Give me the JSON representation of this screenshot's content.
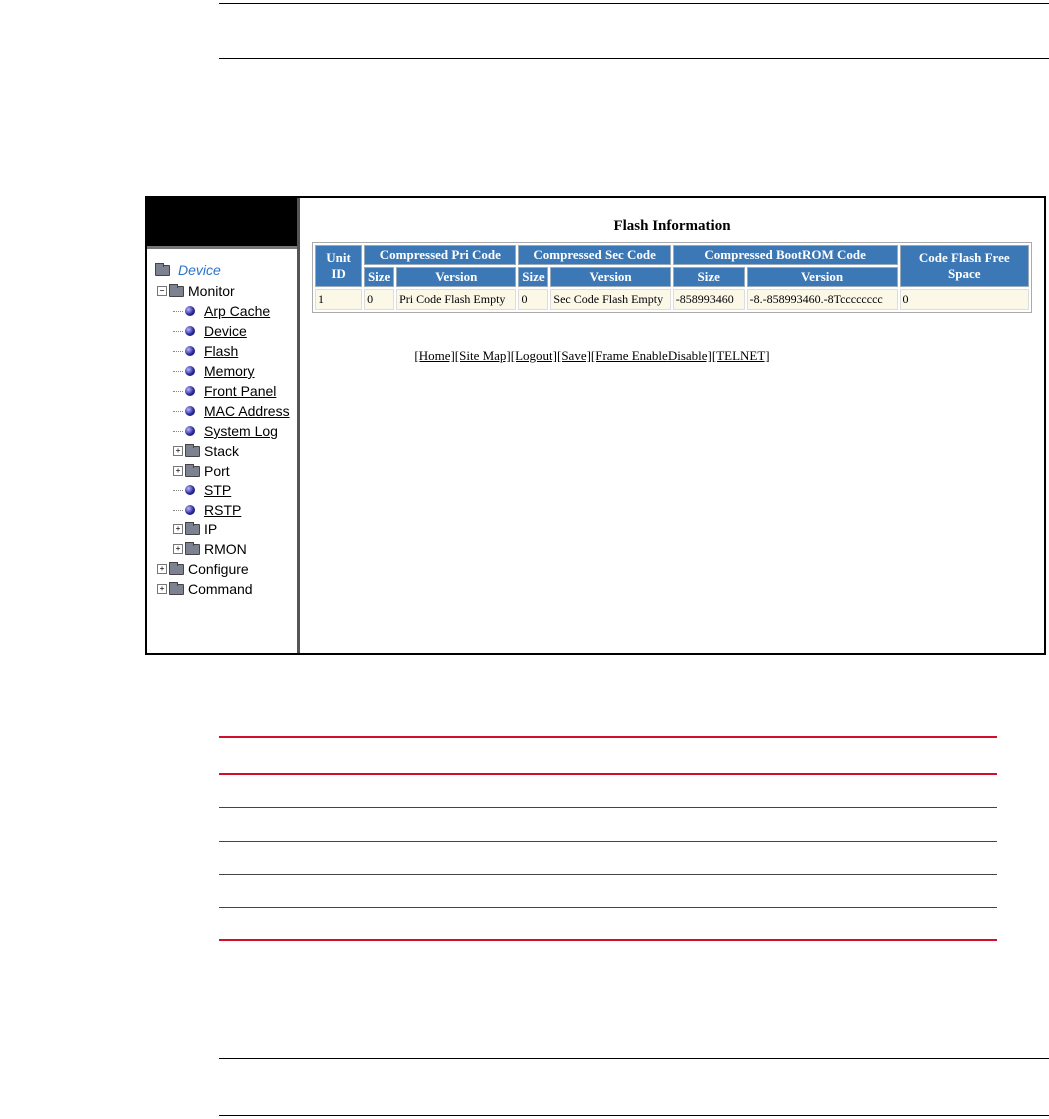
{
  "tree": {
    "root_label": "Device",
    "items": [
      {
        "label": "Monitor",
        "kind": "folder-open",
        "level": 0
      },
      {
        "label": "Arp Cache",
        "kind": "leaf",
        "level": 1
      },
      {
        "label": "Device",
        "kind": "leaf",
        "level": 1
      },
      {
        "label": "Flash",
        "kind": "leaf",
        "level": 1
      },
      {
        "label": "Memory",
        "kind": "leaf",
        "level": 1
      },
      {
        "label": "Front Panel",
        "kind": "leaf",
        "level": 1
      },
      {
        "label": "MAC Address",
        "kind": "leaf",
        "level": 1
      },
      {
        "label": "System Log",
        "kind": "leaf",
        "level": 1
      },
      {
        "label": "Stack",
        "kind": "folder",
        "level": 1
      },
      {
        "label": "Port",
        "kind": "folder",
        "level": 1
      },
      {
        "label": "STP",
        "kind": "leaf",
        "level": 1
      },
      {
        "label": "RSTP",
        "kind": "leaf",
        "level": 1
      },
      {
        "label": "IP",
        "kind": "folder",
        "level": 1
      },
      {
        "label": "RMON",
        "kind": "folder",
        "level": 1
      },
      {
        "label": "Configure",
        "kind": "folder",
        "level": 0
      },
      {
        "label": "Command",
        "kind": "folder",
        "level": 0
      }
    ]
  },
  "main": {
    "title": "Flash Information",
    "headers": {
      "unit_id": "Unit ID",
      "pri": "Compressed Pri Code",
      "sec": "Compressed Sec Code",
      "bootrom": "Compressed BootROM Code",
      "free": "Code Flash Free Space",
      "size": "Size",
      "version": "Version"
    },
    "row": {
      "unit": "1",
      "pri_size": "0",
      "pri_version": "Pri Code Flash Empty",
      "sec_size": "0",
      "sec_version": "Sec Code Flash Empty",
      "boot_size": "-858993460",
      "boot_version": "-8.-858993460.-8Tcccccccc",
      "free": "0"
    },
    "nav": [
      "[Home]",
      "[Site Map]",
      "[Logout]",
      "[Save]",
      "[Frame Enable",
      "Disable]",
      "[TELNET]"
    ]
  }
}
